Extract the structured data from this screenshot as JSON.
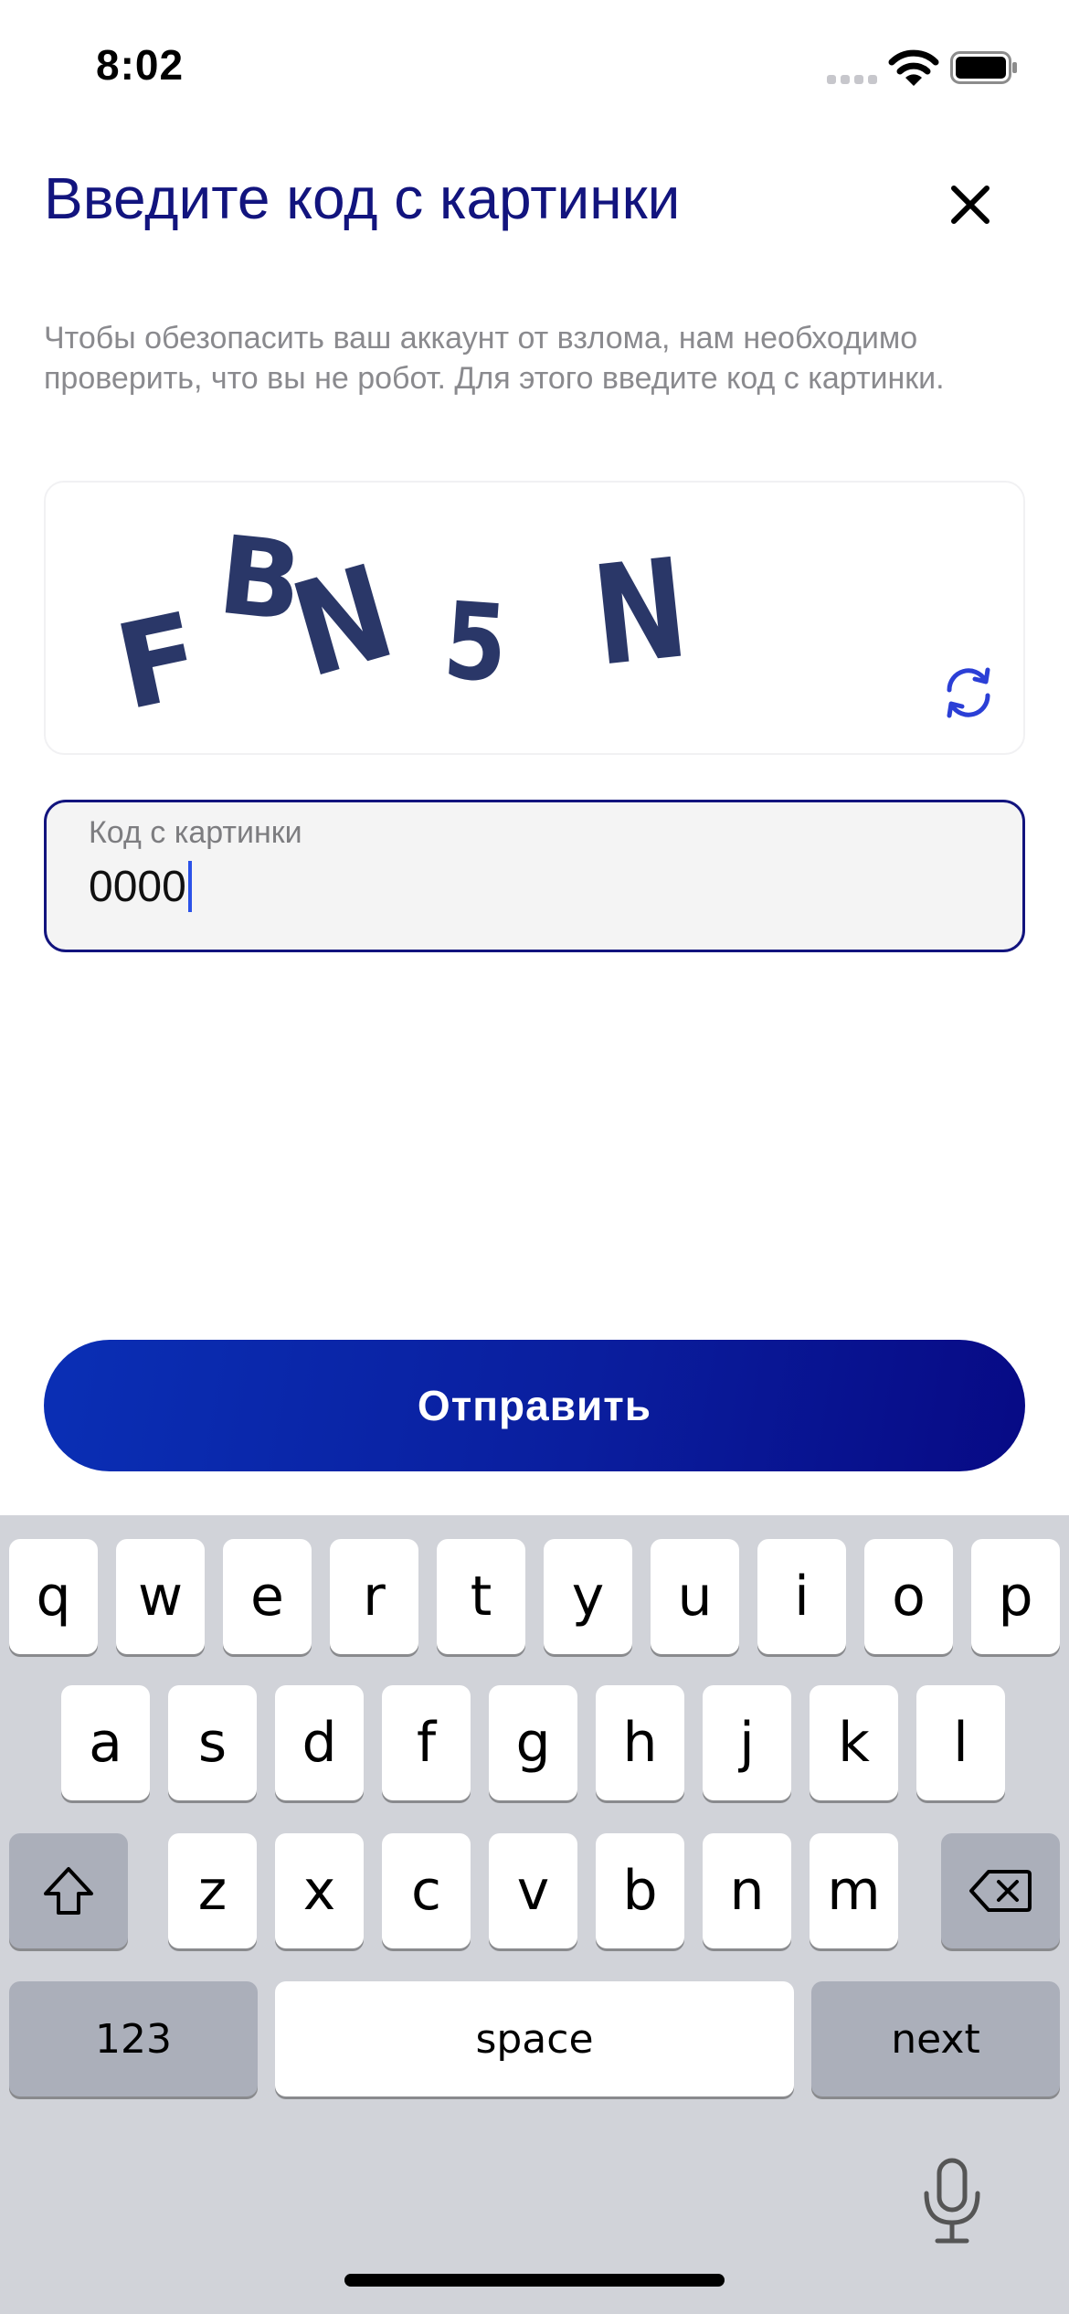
{
  "status_bar": {
    "time": "8:02"
  },
  "header": {
    "title": "Введите код с картинки",
    "close_icon": "close-icon"
  },
  "description": "Чтобы обезопасить ваш аккаунт от взлома, нам необходимо проверить, что вы не робот. Для этого введите код с картинки.",
  "captcha": {
    "text": "FBN5N",
    "refresh_icon": "refresh-icon"
  },
  "code_field": {
    "label": "Код с картинки",
    "value": "0000"
  },
  "submit": {
    "label": "Отправить"
  },
  "keyboard": {
    "row1": [
      "q",
      "w",
      "e",
      "r",
      "t",
      "y",
      "u",
      "i",
      "o",
      "p"
    ],
    "row2": [
      "a",
      "s",
      "d",
      "f",
      "g",
      "h",
      "j",
      "k",
      "l"
    ],
    "row3": [
      "z",
      "x",
      "c",
      "v",
      "b",
      "n",
      "m"
    ],
    "numbers_label": "123",
    "space_label": "space",
    "next_label": "next",
    "shift_icon": "shift-icon",
    "delete_icon": "delete-icon",
    "mic_icon": "microphone-icon"
  },
  "colors": {
    "accent": "#12147e",
    "button_start": "#0a2fb5",
    "button_end": "#070a85",
    "keyboard_bg": "#d1d3d9"
  }
}
